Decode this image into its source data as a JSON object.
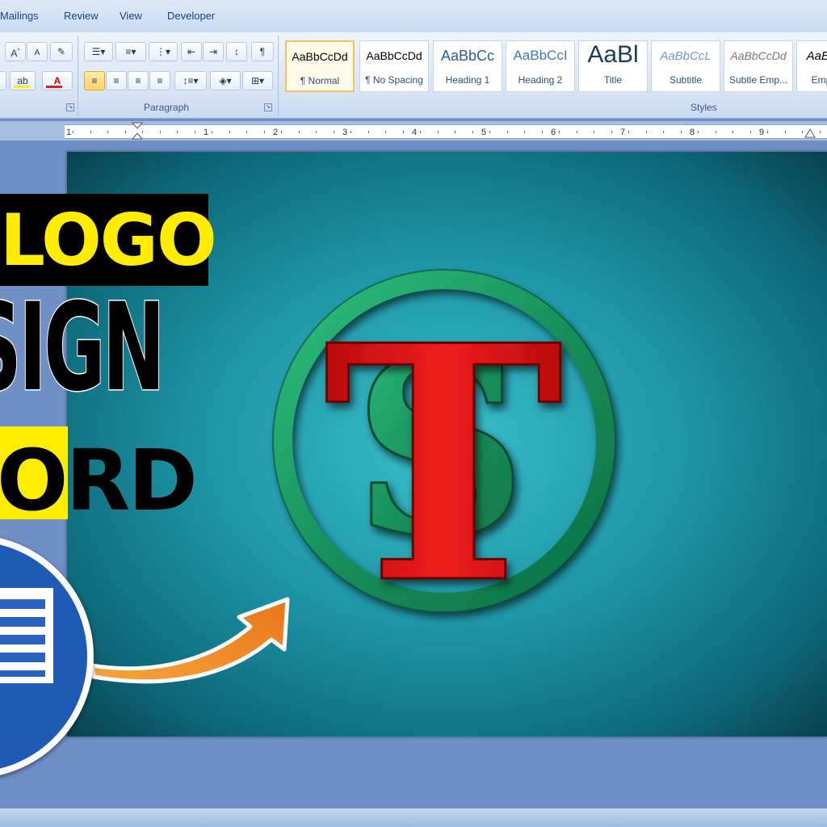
{
  "tabs": [
    {
      "label": "Mailings"
    },
    {
      "label": "Review"
    },
    {
      "label": "View"
    },
    {
      "label": "Developer"
    }
  ],
  "ribbon": {
    "paragraph_label": "Paragraph",
    "styles_label": "Styles",
    "styles": [
      {
        "sample": "AaBbCcDd",
        "name": "¶ Normal",
        "selected": true
      },
      {
        "sample": "AaBbCcDd",
        "name": "¶ No Spacing"
      },
      {
        "sample": "AaBbCc",
        "name": "Heading 1"
      },
      {
        "sample": "AaBbCcI",
        "name": "Heading 2"
      },
      {
        "sample": "AaBl",
        "name": "Title"
      },
      {
        "sample": "AaBbCcL",
        "name": "Subtitle"
      },
      {
        "sample": "AaBbCcDd",
        "name": "Subtle Emp..."
      },
      {
        "sample": "AaBb",
        "name": "Emp"
      }
    ],
    "font_color": "#e02020",
    "highlight_color": "#ffee00"
  },
  "ruler": {
    "numbers": [
      "1",
      "1",
      "2",
      "3",
      "4",
      "5",
      "6",
      "7",
      "8",
      "9"
    ]
  },
  "overlay": {
    "line1": "LOGO",
    "line2": "SIGN",
    "line3": "ORD"
  },
  "logo": {
    "letters": [
      "T",
      "S"
    ],
    "ring_color": "#1fa06a",
    "t_color": "#e01515",
    "s_color": "#1fa06a"
  },
  "arrow_color": "#f28a1a"
}
